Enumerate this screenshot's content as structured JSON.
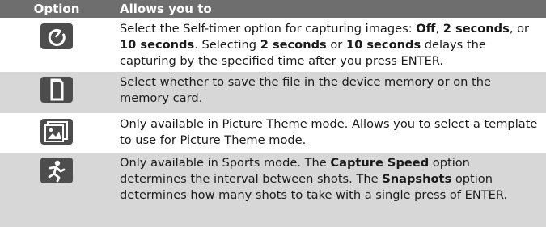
{
  "header": {
    "option": "Option",
    "allows": "Allows you to"
  },
  "rows": [
    {
      "icon": "self-timer-icon",
      "parts": [
        {
          "t": "Select the Self-timer option for capturing images: ",
          "b": false
        },
        {
          "t": "Off",
          "b": true
        },
        {
          "t": ", ",
          "b": false
        },
        {
          "t": "2 seconds",
          "b": true
        },
        {
          "t": ", or ",
          "b": false
        },
        {
          "t": "10 seconds",
          "b": true
        },
        {
          "t": ". Selecting ",
          "b": false
        },
        {
          "t": "2 seconds",
          "b": true
        },
        {
          "t": " or ",
          "b": false
        },
        {
          "t": "10 seconds",
          "b": true
        },
        {
          "t": " delays the capturing by the specified time after you press ENTER.",
          "b": false
        }
      ]
    },
    {
      "icon": "memory-card-icon",
      "parts": [
        {
          "t": "Select whether to save the file in the device memory or on the memory card.",
          "b": false
        }
      ]
    },
    {
      "icon": "picture-theme-icon",
      "parts": [
        {
          "t": "Only available in Picture Theme mode. Allows you to select a template to use for Picture Theme mode.",
          "b": false
        }
      ]
    },
    {
      "icon": "sports-mode-icon",
      "parts": [
        {
          "t": "Only available in Sports mode. The ",
          "b": false
        },
        {
          "t": "Capture Speed",
          "b": true
        },
        {
          "t": " option determines the interval between shots. The ",
          "b": false
        },
        {
          "t": "Snapshots",
          "b": true
        },
        {
          "t": " option determines how many shots to take with a single press of ENTER.",
          "b": false
        }
      ]
    }
  ]
}
